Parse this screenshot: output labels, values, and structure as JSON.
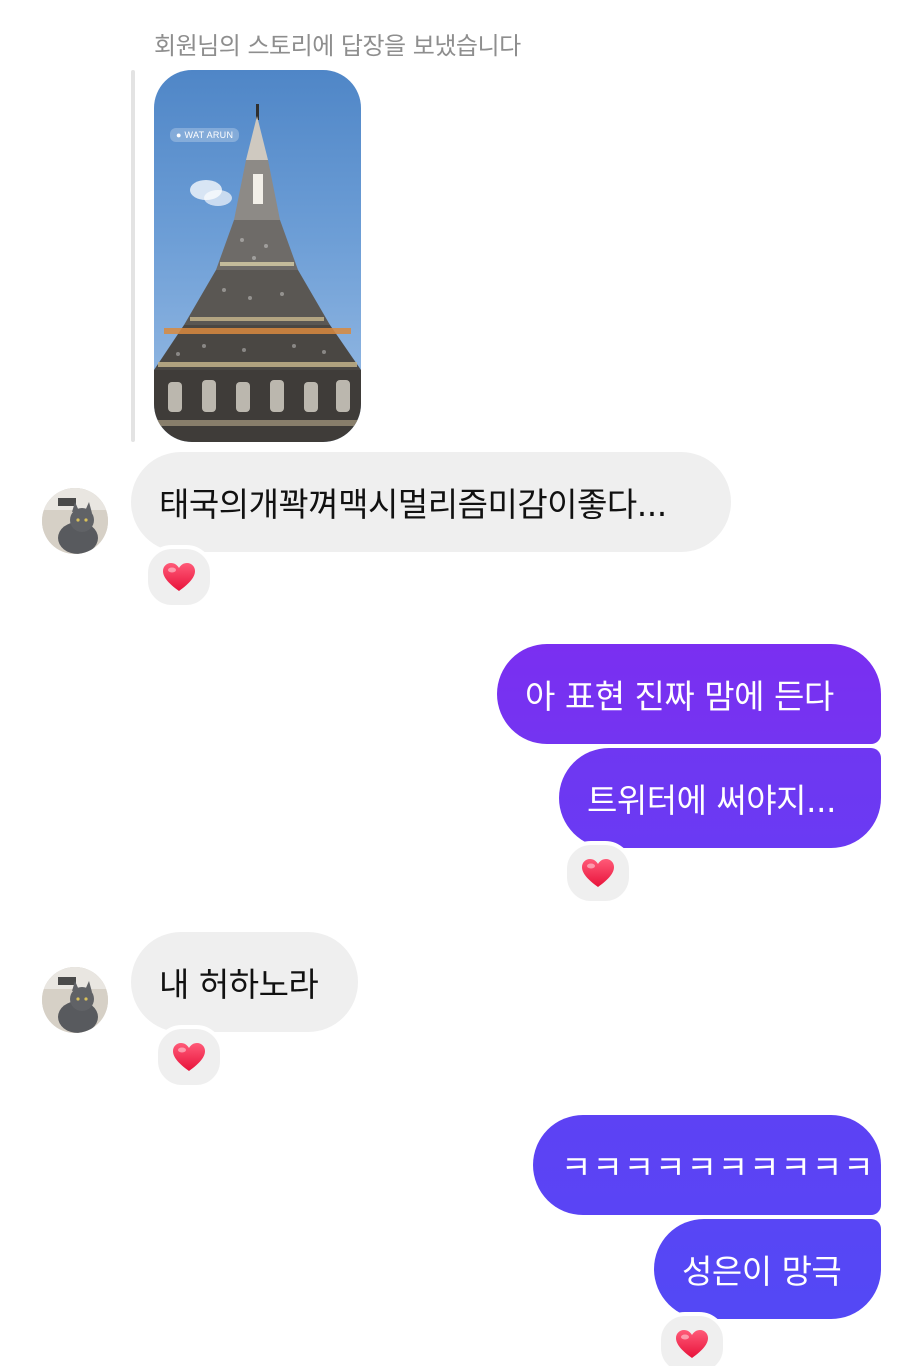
{
  "story": {
    "caption": "회원님의 스토리에 답장을 보냈습니다",
    "location_tag": "WAT ARUN"
  },
  "messages": {
    "m1": {
      "text": "태국의개꽉껴맥시멀리즘미감이좋다..."
    },
    "m2": {
      "text": "아 표현 진짜 맘에 든다"
    },
    "m3": {
      "text": "트위터에 써야지..."
    },
    "m4": {
      "text": "내 허하노라"
    },
    "m5": {
      "text": "ㅋㅋㅋㅋㅋㅋㅋㅋㅋㅋ"
    },
    "m6": {
      "text": "성은이 망극"
    }
  },
  "icons": {
    "reaction": "red-heart-icon",
    "avatar": "cat-avatar"
  },
  "colors": {
    "incoming_bubble": "#efefef",
    "outgoing_gradient_top": "#7b2ff0",
    "outgoing_gradient_bottom": "#5146f5",
    "caption": "#8e8e8e",
    "heart": "#ff2f55"
  }
}
